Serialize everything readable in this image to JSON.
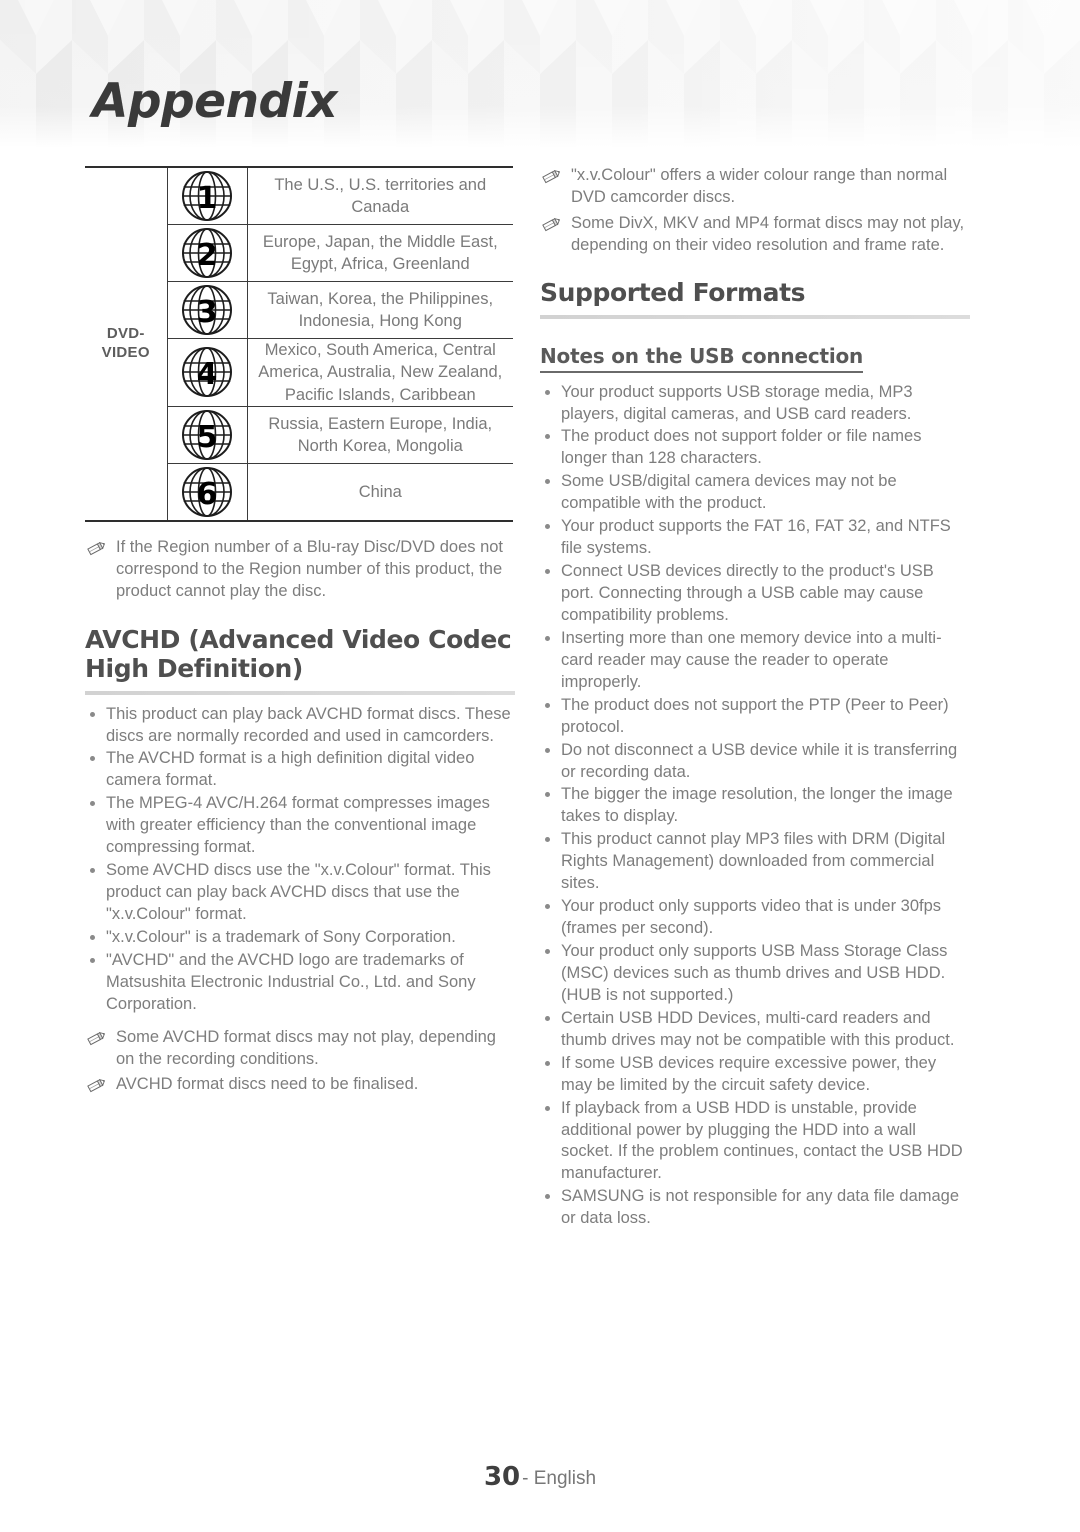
{
  "header": {
    "title": "Appendix"
  },
  "region_table": {
    "category_label": "DVD-\nVIDEO",
    "category_line1": "DVD-",
    "category_line2": "VIDEO",
    "rows": [
      {
        "number": "1",
        "regions": "The U.S., U.S. territories and Canada"
      },
      {
        "number": "2",
        "regions": "Europe, Japan, the Middle East, Egypt, Africa, Greenland"
      },
      {
        "number": "3",
        "regions": "Taiwan, Korea, the Philippines, Indonesia, Hong Kong"
      },
      {
        "number": "4",
        "regions": "Mexico, South America, Central America, Australia, New Zealand, Pacific Islands, Caribbean"
      },
      {
        "number": "5",
        "regions": "Russia, Eastern Europe, India, North Korea, Mongolia"
      },
      {
        "number": "6",
        "regions": "China"
      }
    ]
  },
  "left_column": {
    "region_note": "If the Region number of a Blu-ray Disc/DVD does not correspond to the Region number of this product, the product cannot play the disc.",
    "avchd_heading": "AVCHD (Advanced Video Codec High Definition)",
    "avchd_bullets": [
      "This product can play back AVCHD format discs. These discs are normally recorded and used in camcorders.",
      "The AVCHD format is a high definition digital video camera format.",
      "The MPEG-4 AVC/H.264 format compresses images with greater efficiency than the conventional image compressing format.",
      "Some AVCHD discs use the \"x.v.Colour\" format. This product can play back AVCHD discs that use the \"x.v.Colour\" format.",
      "\"x.v.Colour\" is a trademark of Sony Corporation.",
      "\"AVCHD\" and the AVCHD logo are trademarks of Matsushita Electronic Industrial Co., Ltd. and Sony Corporation."
    ],
    "avchd_notes": [
      "Some AVCHD format discs may not play, depending on the recording conditions.",
      "AVCHD format discs need to be finalised."
    ]
  },
  "right_column": {
    "top_notes": [
      "\"x.v.Colour\" offers a wider colour range than normal DVD camcorder discs.",
      "Some DivX, MKV and MP4 format discs may not play, depending on their video resolution and frame rate."
    ],
    "supported_formats_heading": "Supported Formats",
    "usb_subheading": "Notes on the USB connection",
    "usb_bullets": [
      "Your product supports USB storage media, MP3 players, digital cameras, and USB card readers.",
      "The product does not support folder or file names longer than 128 characters.",
      "Some USB/digital camera devices may not be compatible with the product.",
      "Your product supports the FAT 16, FAT 32, and NTFS file systems.",
      "Connect USB devices directly to the product's USB port. Connecting through a USB cable may cause compatibility problems.",
      "Inserting more than one memory device into a multi-card reader may cause the reader to operate improperly.",
      "The product does not support the PTP (Peer to Peer) protocol.",
      "Do not disconnect a USB device while it is transferring or recording data.",
      "The bigger the image resolution, the longer the image takes to display.",
      "This product cannot play MP3 files with DRM (Digital Rights Management) downloaded from commercial sites.",
      "Your product only supports video that is under 30fps (frames per second).",
      "Your product only supports USB Mass Storage Class (MSC) devices such as thumb drives and USB HDD. (HUB is not supported.)",
      "Certain USB HDD Devices, multi-card readers and thumb drives may not be compatible with this product.",
      "If some USB devices require excessive power, they may be limited by the circuit safety device.",
      "If playback from a USB HDD is unstable, provide additional power by plugging the HDD into a wall socket. If the problem continues, contact the USB HDD manufacturer.",
      "SAMSUNG is not responsible for any data file damage or data loss."
    ]
  },
  "footer": {
    "page_number": "30",
    "separator_language": "- English"
  },
  "icons": {
    "globe": "globe-region-icon",
    "note": "pencil-note-icon",
    "bullet": "bullet-dot-icon"
  },
  "colors": {
    "text": "#7d7d7d",
    "heading": "#4f4f4f",
    "rule": "#d2d2d2",
    "table_border": "#3b3b3b"
  }
}
